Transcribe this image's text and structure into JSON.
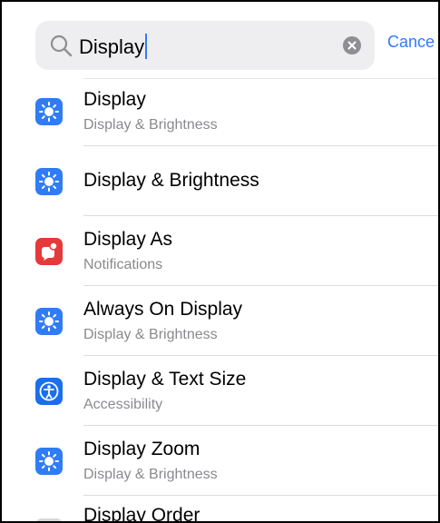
{
  "search": {
    "value": "Display",
    "cancel_label": "Cance"
  },
  "results": [
    {
      "title": "Display",
      "subtitle": "Display & Brightness",
      "icon": "sun-icon",
      "color": "#2f7cf6"
    },
    {
      "title": "Display & Brightness",
      "subtitle": "",
      "icon": "sun-icon",
      "color": "#2f7cf6"
    },
    {
      "title": "Display As",
      "subtitle": "Notifications",
      "icon": "notifications-icon",
      "color": "#e5393a"
    },
    {
      "title": "Always On Display",
      "subtitle": "Display & Brightness",
      "icon": "sun-icon",
      "color": "#2f7cf6"
    },
    {
      "title": "Display & Text Size",
      "subtitle": "Accessibility",
      "icon": "accessibility-icon",
      "color": "#1a6ff0"
    },
    {
      "title": "Display Zoom",
      "subtitle": "Display & Brightness",
      "icon": "sun-icon",
      "color": "#2f7cf6"
    },
    {
      "title": "Display Order",
      "subtitle": "",
      "icon": "contacts-icon",
      "color": "#c9c9cc"
    }
  ]
}
